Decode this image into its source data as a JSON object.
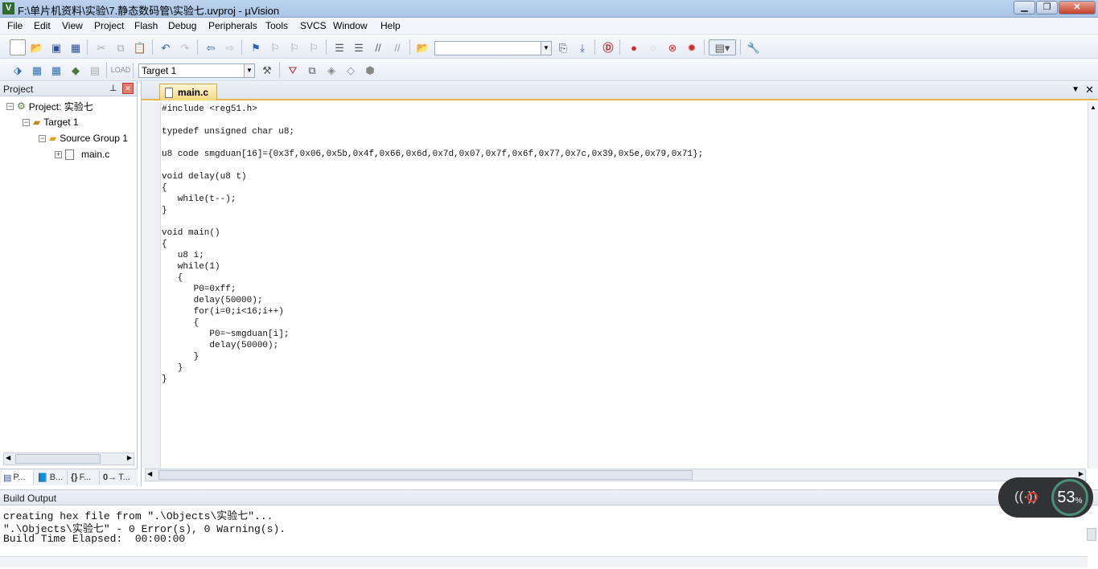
{
  "window": {
    "title": "F:\\单片机资料\\实验\\7.静态数码管\\实验七.uvproj - µVision",
    "app_icon": "V"
  },
  "window_buttons": {
    "minimize": "▁",
    "maximize": "❐",
    "close": "✕"
  },
  "menu": [
    "File",
    "Edit",
    "View",
    "Project",
    "Flash",
    "Debug",
    "Peripherals",
    "Tools",
    "SVCS",
    "Window",
    "Help"
  ],
  "toolbar1": {
    "search_value": ""
  },
  "toolbar2": {
    "target": "Target 1"
  },
  "project_panel": {
    "title": "Project",
    "pin_glyph": "⊥",
    "close_glyph": "✕",
    "tree": {
      "project": "Project: 实验七",
      "target": "Target 1",
      "group": "Source Group 1",
      "file": "main.c"
    },
    "tabs": [
      "P...",
      "B...",
      "F...",
      "T..."
    ]
  },
  "editor": {
    "tab": "main.c",
    "lines": [
      "#include <reg51.h>",
      "",
      "typedef unsigned char u8;",
      "",
      "u8 code smgduan[16]={0x3f,0x06,0x5b,0x4f,0x66,0x6d,0x7d,0x07,0x7f,0x6f,0x77,0x7c,0x39,0x5e,0x79,0x71};",
      "",
      "void delay(u8 t)",
      "{",
      "   while(t--);",
      "}",
      "",
      "void main()",
      "{",
      "   u8 i;",
      "   while(1)",
      "   {",
      "      P0=0xff;",
      "      delay(50000);",
      "      for(i=0;i<16;i++)",
      "      {",
      "         P0=~smgduan[i];",
      "         delay(50000);",
      "      }",
      "   }",
      "}"
    ]
  },
  "build_output": {
    "title": "Build Output",
    "lines": [
      "creating hex file from \".\\Objects\\实验七\"...",
      "\".\\Objects\\实验七\" - 0 Error(s), 0 Warning(s).",
      "Build Time Elapsed:  00:00:00"
    ]
  },
  "overlay": {
    "percent": "53",
    "unit": "%"
  },
  "colors": {
    "accent_tab": "#f6d77e",
    "title_bar": "#bcd3ee"
  }
}
